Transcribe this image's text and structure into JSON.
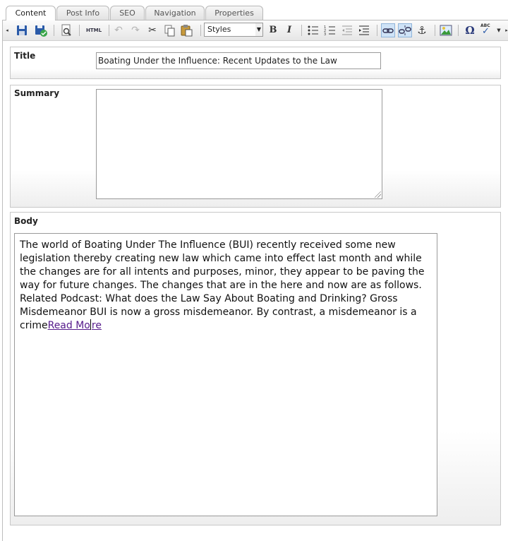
{
  "tabs": [
    {
      "label": "Content",
      "active": true
    },
    {
      "label": "Post Info",
      "active": false
    },
    {
      "label": "SEO",
      "active": false
    },
    {
      "label": "Navigation",
      "active": false
    },
    {
      "label": "Properties",
      "active": false
    }
  ],
  "toolbar": {
    "html_label": "HTML",
    "styles_value": "Styles",
    "bold_label": "B",
    "italic_label": "I",
    "omega_label": "Ω",
    "spell_label": "ABC"
  },
  "title_section": {
    "label": "Title",
    "value": "Boating Under the Influence: Recent Updates to the Law"
  },
  "summary_section": {
    "label": "Summary",
    "value": ""
  },
  "body_section": {
    "label": "Body",
    "text": "The world of Boating Under The Influence (BUI) recently received some new legislation thereby creating new law which came into effect last month and while the changes are for all intents and purposes, minor, they appear to be paving the way for future changes.  The changes that are in the here and now are as follows. Related Podcast: What does the Law Say About Boating and Drinking? Gross Misdemeanor BUI is now a gross misdemeanor.  By contrast, a misdemeanor is a crime",
    "link_before_caret": "Read Mo",
    "link_after_caret": "re"
  },
  "colors": {
    "link": "#551a8b",
    "border": "#9a9a9a",
    "toolbar_active": "#cfe3f7"
  }
}
